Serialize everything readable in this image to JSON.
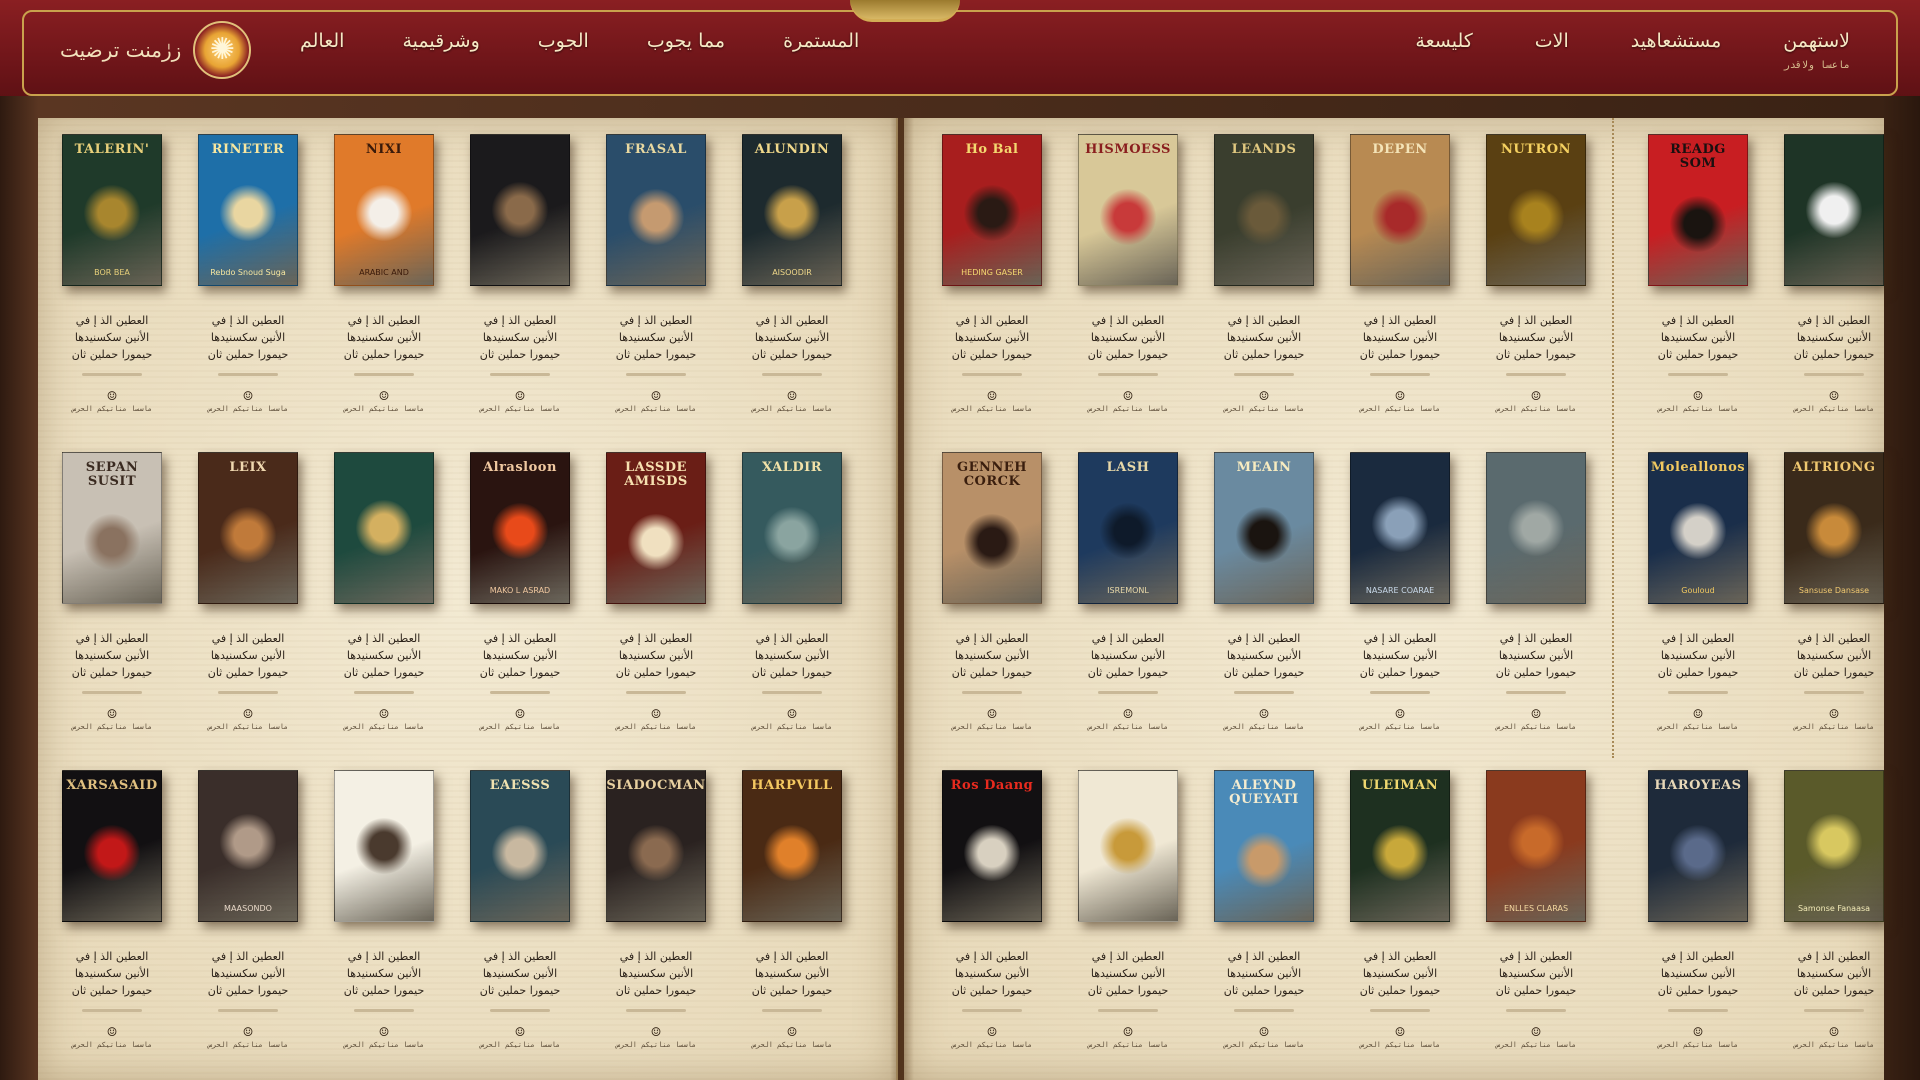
{
  "header": {
    "brand_text": "زرٰمنت ترضيت",
    "nav_left": [
      "المستمرة",
      "مما يجوب",
      "الجوب",
      "وشرقيمية",
      "العالم"
    ],
    "nav_right": [
      "لاستهمن",
      "مستشعاهيد",
      "الات",
      "كليسعة"
    ],
    "nav_sub": "ماعسا ولاقدر"
  },
  "colors": {
    "header": "#6e1519",
    "gold": "#c9a24d",
    "page": "#ede2c8"
  },
  "left_books": [
    {
      "title": "TALERIN'",
      "sub": "BOR BEA",
      "bg": "#1f3a2a",
      "fg": "#e7cf7a",
      "art": "#a8862e"
    },
    {
      "title": "RINETER",
      "sub": "Rebdo Snoud Suga",
      "bg": "#1e6fa8",
      "fg": "#f8e7a0",
      "art": "#e9d6a1"
    },
    {
      "title": "NIXI",
      "sub": "ARABIC AND",
      "bg": "#e07a2a",
      "fg": "#3a1a0a",
      "art": "#f4efe8"
    },
    {
      "title": "",
      "sub": "",
      "bg": "#1b1a1c",
      "fg": "#d9c8a3",
      "art": "#8a6a4a"
    },
    {
      "title": "FRASAL",
      "sub": "",
      "bg": "#2a4d6a",
      "fg": "#e8d8a0",
      "art": "#c59a70"
    },
    {
      "title": "ALUNDIN",
      "sub": "AISOODIR",
      "bg": "#1d2a2e",
      "fg": "#f0d88a",
      "art": "#c8a04a"
    },
    {
      "title": "SEPAN SUSIT",
      "sub": "",
      "bg": "#c8c0b4",
      "fg": "#3a2a20",
      "art": "#8a7260"
    },
    {
      "title": "LEIX",
      "sub": "",
      "bg": "#4a2a1a",
      "fg": "#f0d8b0",
      "art": "#c07a3a"
    },
    {
      "title": "",
      "sub": "",
      "bg": "#1e4a3e",
      "fg": "#e8d090",
      "art": "#d4b060"
    },
    {
      "title": "Alrasloon",
      "sub": "MAKO L ASRAD",
      "bg": "#2a1410",
      "fg": "#f0c8a0",
      "art": "#e84a1a"
    },
    {
      "title": "LASSDE AMISDS",
      "sub": "",
      "bg": "#6a1e16",
      "fg": "#f6e0b0",
      "art": "#f0e0c0"
    },
    {
      "title": "XALDIR",
      "sub": "",
      "bg": "#355a5e",
      "fg": "#f2e2a8",
      "art": "#8aa4a0"
    },
    {
      "title": "XARSASAID",
      "sub": "",
      "bg": "#121012",
      "fg": "#e0c080",
      "art": "#c21818"
    },
    {
      "title": "",
      "sub": "MAASONDO",
      "bg": "#3a2e2a",
      "fg": "#e8d8c8",
      "art": "#b09a88"
    },
    {
      "title": "",
      "sub": "",
      "bg": "#f4f0e4",
      "fg": "#3a2a1a",
      "art": "#4a3a2e"
    },
    {
      "title": "EAESSS",
      "sub": "",
      "bg": "#2a4a56",
      "fg": "#f0e2b0",
      "art": "#c8b8a0"
    },
    {
      "title": "SIADOCMAN",
      "sub": "",
      "bg": "#2a2220",
      "fg": "#e8d0a0",
      "art": "#8a6a50"
    },
    {
      "title": "HARPVILL",
      "sub": "",
      "bg": "#4a2a14",
      "fg": "#f4c860",
      "art": "#e0802a"
    }
  ],
  "right_books": [
    {
      "title": "Ho Bal",
      "sub": "HEDING GASER",
      "bg": "#a81e1e",
      "fg": "#f4d870",
      "art": "#2a1a14"
    },
    {
      "title": "HISMOESS",
      "sub": "",
      "bg": "#d8c898",
      "fg": "#8a1e1e",
      "art": "#c83a3a"
    },
    {
      "title": "LEANDS",
      "sub": "",
      "bg": "#3a3e2e",
      "fg": "#e0c880",
      "art": "#6a5a3a"
    },
    {
      "title": "DEPEN",
      "sub": "",
      "bg": "#b88a52",
      "fg": "#f4e4b8",
      "art": "#a82a2a"
    },
    {
      "title": "NUTRON",
      "sub": "",
      "bg": "#5a4012",
      "fg": "#f4d060",
      "art": "#a8821e"
    },
    {
      "title": "GENNEH CORCK",
      "sub": "",
      "bg": "#b89068",
      "fg": "#3a1e0e",
      "art": "#2a1a14"
    },
    {
      "title": "LASH",
      "sub": "ISREMONL",
      "bg": "#1e3a5e",
      "fg": "#e8d8a8",
      "art": "#0e1a2a"
    },
    {
      "title": "MEAIN",
      "sub": "",
      "bg": "#6a8aa0",
      "fg": "#f8ecc0",
      "art": "#1a1410"
    },
    {
      "title": "",
      "sub": "NASARE COARAE",
      "bg": "#1a2a3e",
      "fg": "#c8d8e8",
      "art": "#8aa0b8"
    },
    {
      "title": "",
      "sub": "",
      "bg": "#5a6a6e",
      "fg": "#e0e4e0",
      "art": "#a0a8a4"
    },
    {
      "title": "Ros Daang",
      "sub": "",
      "bg": "#121012",
      "fg": "#e82a1e",
      "art": "#d8d0c0"
    },
    {
      "title": "",
      "sub": "",
      "bg": "#f0e8d4",
      "fg": "#6a4a1e",
      "art": "#c89a3a"
    },
    {
      "title": "ALEYND QUEYATI",
      "sub": "",
      "bg": "#4a8ab8",
      "fg": "#f4ecd0",
      "art": "#c89a6a"
    },
    {
      "title": "ULEIMAN",
      "sub": "",
      "bg": "#1e3020",
      "fg": "#f0d870",
      "art": "#c8a83a"
    },
    {
      "title": "",
      "sub": "ENLLES CLARAS",
      "bg": "#8a3a1e",
      "fg": "#f4d8a0",
      "art": "#c86a2a"
    }
  ],
  "right_books_2": [
    {
      "title": "READG SOM",
      "sub": "",
      "bg": "#c81e22",
      "fg": "#1a1010",
      "art": "#1a1410"
    },
    {
      "title": "",
      "sub": "",
      "bg": "#1e3426",
      "fg": "#e8d8a0",
      "art": "#f0f0f0"
    },
    {
      "title": "Moleallonos",
      "sub": "Gouloud",
      "bg": "#1a2e4a",
      "fg": "#f0c860",
      "art": "#d4d0c8"
    },
    {
      "title": "ALTRIONG",
      "sub": "Sansuse Dansase",
      "bg": "#3a2a1a",
      "fg": "#f0c870",
      "art": "#c88a3a"
    },
    {
      "title": "HAROYEAS",
      "sub": "",
      "bg": "#1e2a3a",
      "fg": "#e8d8b8",
      "art": "#5a6a8a"
    },
    {
      "title": "",
      "sub": "Samonse Fanaasa",
      "bg": "#5a5a2a",
      "fg": "#f4ecb8",
      "art": "#d8c860"
    }
  ],
  "desc_lines": [
    "العطين الذ إ في",
    "الأنين سكسنيدها",
    "حيمورا حملين ثان"
  ],
  "meta_text": "ماسسا مناتيكم الحرس",
  "meta_icon": "☺"
}
